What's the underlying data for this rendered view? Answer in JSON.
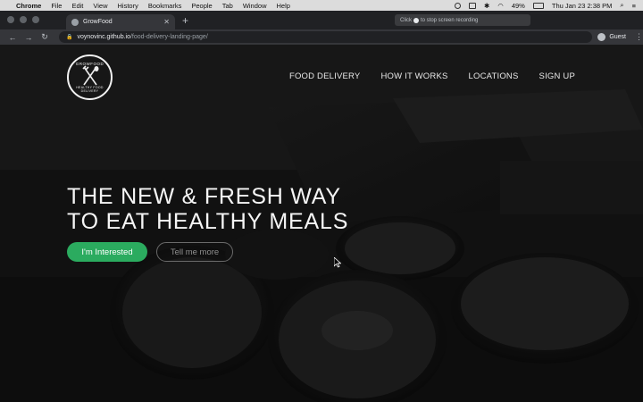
{
  "menubar": {
    "app": "Chrome",
    "items": [
      "File",
      "Edit",
      "View",
      "History",
      "Bookmarks",
      "People",
      "Tab",
      "Window",
      "Help"
    ],
    "battery": "49%",
    "clock": "Thu Jan 23  2:38 PM"
  },
  "browser": {
    "tab_title": "GrowFood",
    "recording_prefix": "Click",
    "recording_suffix": "to stop screen recording",
    "url_host": "voynovinc.github.io",
    "url_path": "/food-delivery-landing-page/",
    "profile": "Guest"
  },
  "page": {
    "logo_top": "GROWFOOD",
    "logo_bottom": "HEALTHY FOOD DELIVERY",
    "nav": [
      "FOOD DELIVERY",
      "HOW IT WORKS",
      "LOCATIONS",
      "SIGN UP"
    ],
    "hero_line1": "THE NEW & FRESH WAY",
    "hero_line2": "TO EAT HEALTHY MEALS",
    "primary_button": "I'm Interested",
    "secondary_button": "Tell me more"
  },
  "colors": {
    "accent": "#2bab5f",
    "overlay": "#000000"
  },
  "icons": [
    "apple-icon",
    "search-icon",
    "wifi-icon",
    "battery-icon",
    "fork-knife-icon",
    "back-icon",
    "forward-icon",
    "reload-icon",
    "lock-icon"
  ]
}
